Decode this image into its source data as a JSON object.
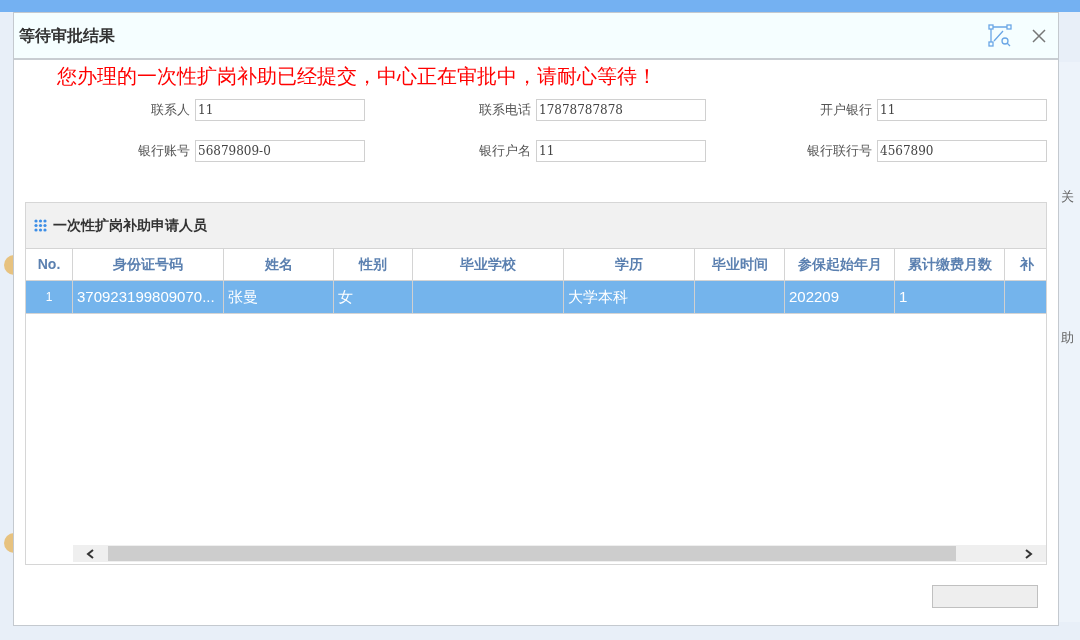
{
  "dialog": {
    "title": "等待审批结果",
    "notice": "您办理的一次性扩岗补助已经提交，中心正在审批中，请耐心等待！"
  },
  "fields": [
    {
      "label": "联系人",
      "value": "11"
    },
    {
      "label": "联系电话",
      "value": "17878787878"
    },
    {
      "label": "开户银行",
      "value": "11"
    },
    {
      "label": "银行账号",
      "value": "56879809-0"
    },
    {
      "label": "银行户名",
      "value": "11"
    },
    {
      "label": "银行联行号",
      "value": "4567890"
    }
  ],
  "panel": {
    "title": "一次性扩岗补助申请人员"
  },
  "table": {
    "columns": [
      "No.",
      "身份证号码",
      "姓名",
      "性别",
      "毕业学校",
      "学历",
      "毕业时间",
      "参保起始年月",
      "累计缴费月数",
      "补"
    ],
    "rows": [
      {
        "selected": true,
        "cells": [
          "1",
          "370923199809070...",
          "张曼",
          "女",
          "",
          "大学本科",
          "",
          "202209",
          "1",
          ""
        ]
      }
    ]
  },
  "background": {
    "side_texts": [
      "关",
      "助"
    ]
  }
}
